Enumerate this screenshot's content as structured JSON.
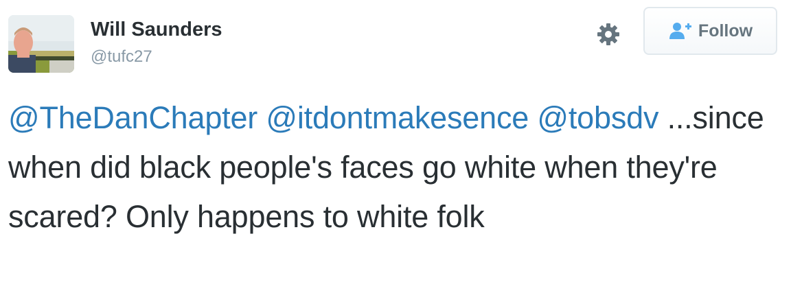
{
  "user": {
    "name": "Will Saunders",
    "handle": "@tufc27"
  },
  "actions": {
    "follow_label": "Follow",
    "settings_icon": "gear-icon",
    "follow_icon": "add-user-icon"
  },
  "tweet": {
    "mentions": [
      "@TheDanChapter",
      "@itdontmakesence",
      "@tobsdv"
    ],
    "body": " ...since when did black people's faces go white when they're scared? Only happens to white folk"
  },
  "colors": {
    "mention": "#2b7bb9",
    "text": "#292f33",
    "muted": "#8899a6",
    "button_border": "#e1e8ed",
    "follow_icon": "#55acee"
  }
}
